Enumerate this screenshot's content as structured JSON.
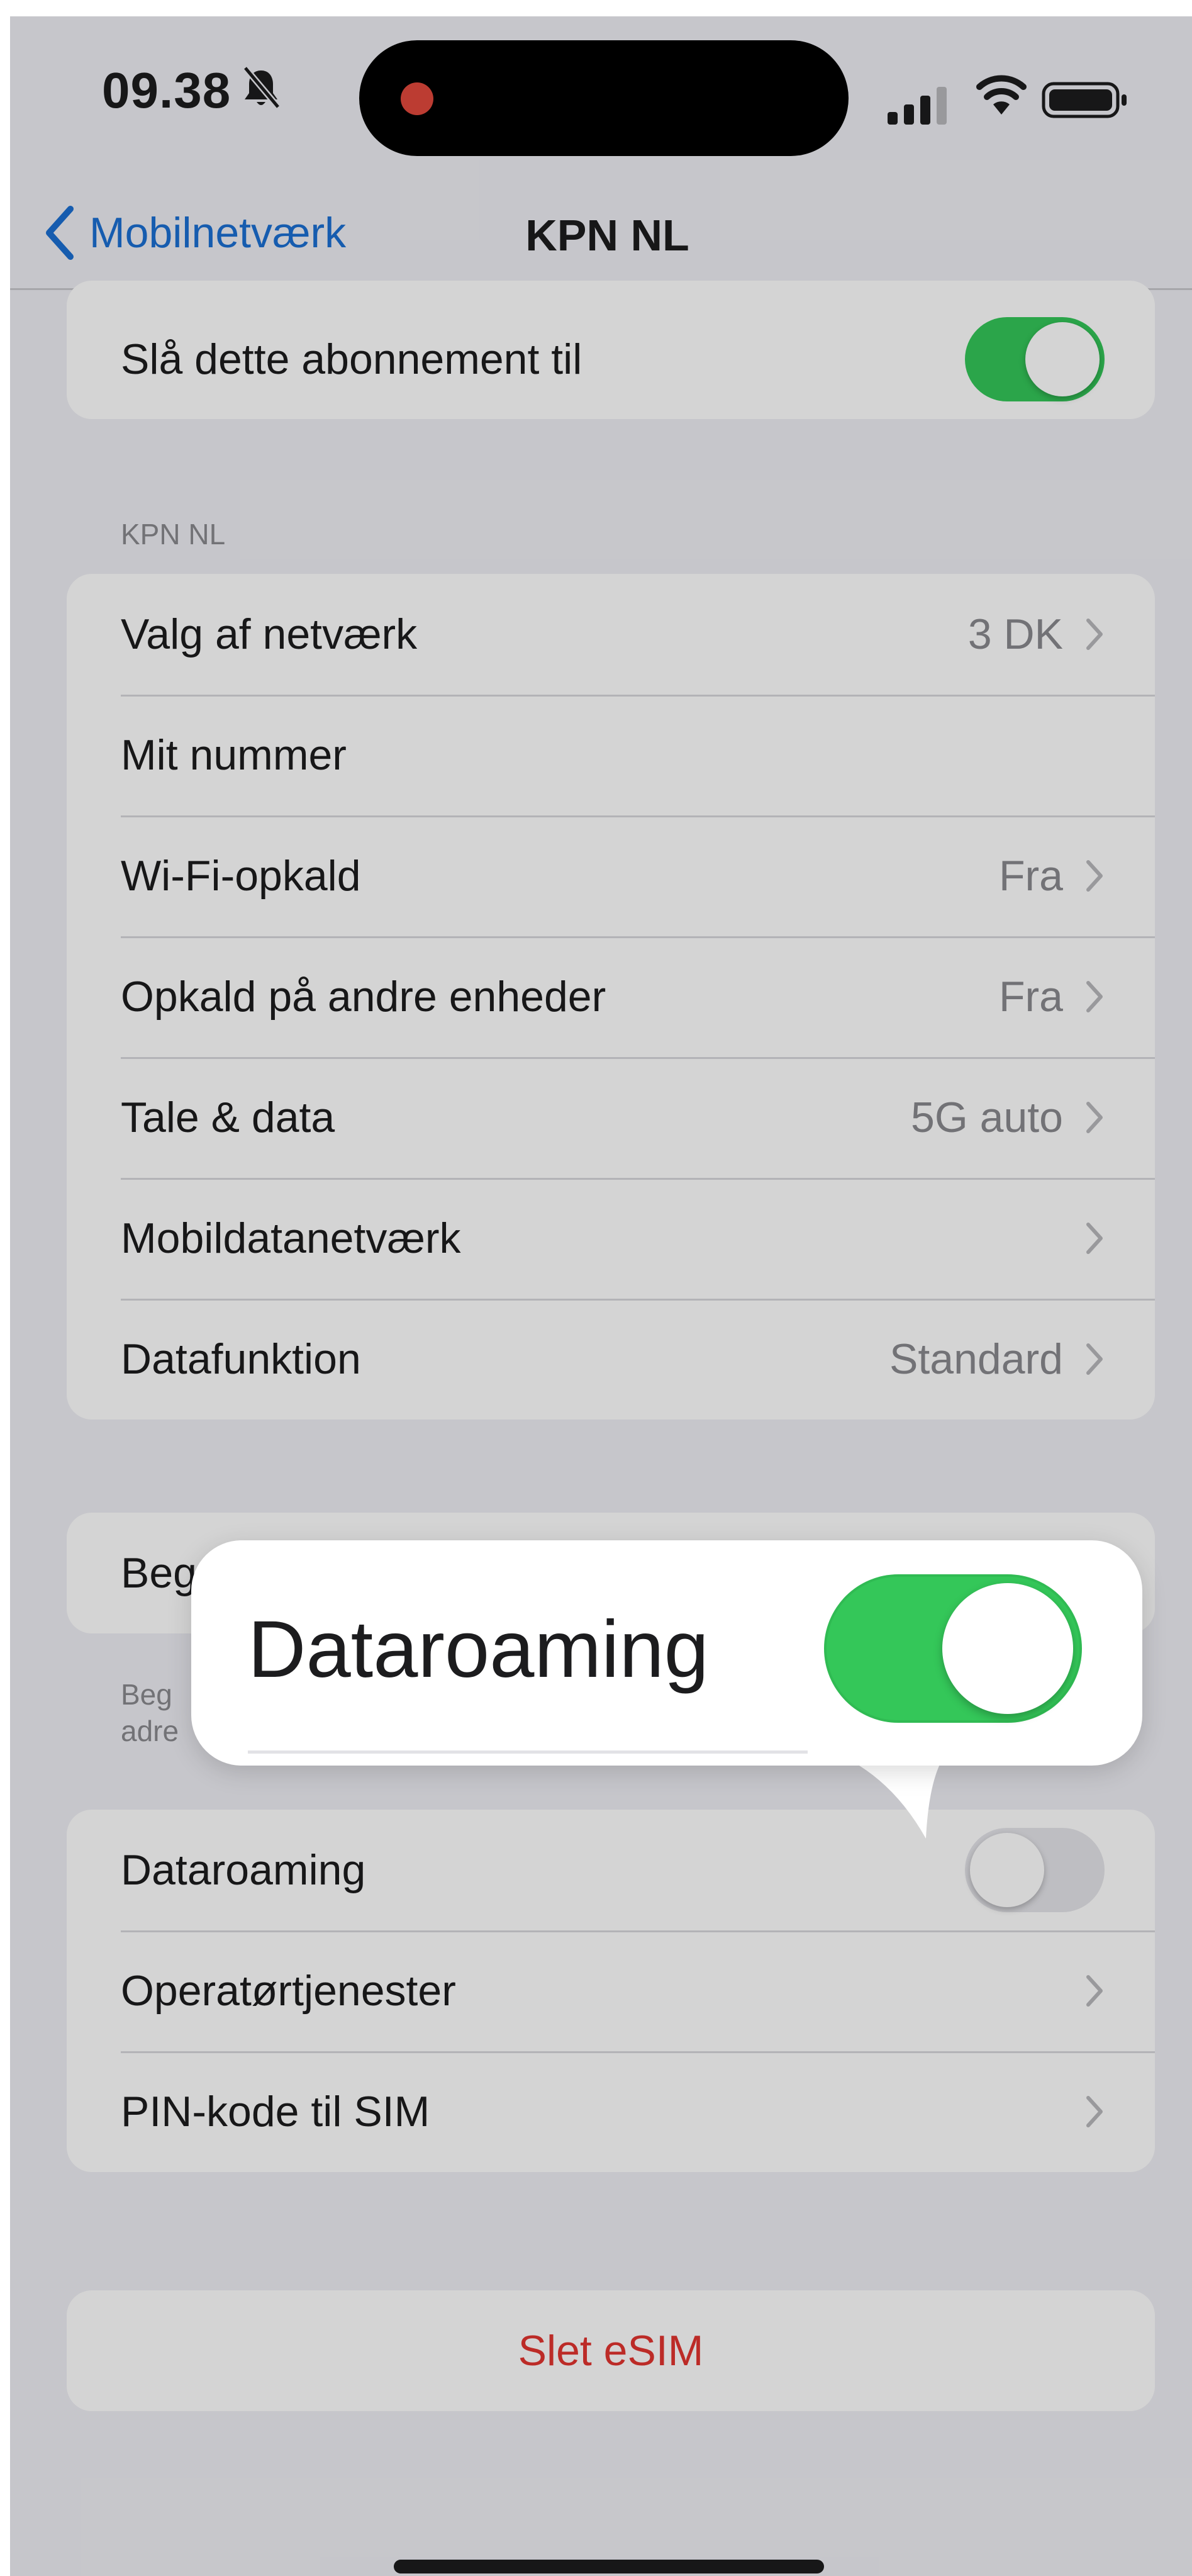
{
  "status_bar": {
    "time": "09.38",
    "icons": [
      "bell-slash-icon",
      "recording-dot-icon",
      "cellular-signal-icon",
      "wifi-icon",
      "battery-icon"
    ]
  },
  "nav": {
    "back_label": "Mobilnetværk",
    "title": "KPN NL"
  },
  "top_group": {
    "label": "Slå dette abonnement til",
    "toggle_on": true
  },
  "section_header": "KPN NL",
  "settings": [
    {
      "label": "Valg af netværk",
      "value": "3 DK",
      "chevron": true
    },
    {
      "label": "Mit nummer",
      "value": "",
      "chevron": false
    },
    {
      "label": "Wi-Fi-opkald",
      "value": "Fra",
      "chevron": true
    },
    {
      "label": "Opkald på andre enheder",
      "value": "Fra",
      "chevron": true
    },
    {
      "label": "Tale & data",
      "value": "5G auto",
      "chevron": true
    },
    {
      "label": "Mobildatanetværk",
      "value": "",
      "chevron": true
    },
    {
      "label": "Datafunktion",
      "value": "Standard",
      "chevron": true
    }
  ],
  "limit_group": {
    "label_partial": "Beg",
    "footer_partial_1": "Beg",
    "footer_partial_2": "adre"
  },
  "roaming_group": [
    {
      "label": "Dataroaming",
      "toggle_on": false
    },
    {
      "label": "Operatørtjenester",
      "chevron": true
    },
    {
      "label": "PIN-kode til SIM",
      "chevron": true
    }
  ],
  "delete_label": "Slet eSIM",
  "callout": {
    "label": "Dataroaming",
    "toggle_on": true
  },
  "colors": {
    "accent_blue": "#1b6fd3",
    "toggle_green": "#34c759",
    "destructive_red": "#e3342f",
    "secondary_text": "#8a8a8e"
  }
}
